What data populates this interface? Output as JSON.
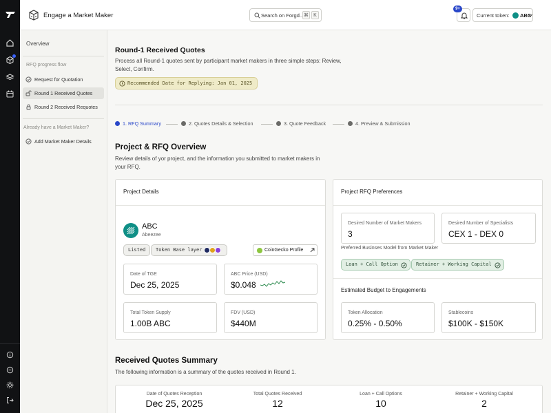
{
  "header": {
    "title": "Engage a Market Maker",
    "search_placeholder": "Search on Forgd...",
    "kbd_1": "⌘",
    "kbd_2": "K",
    "notifications_count": "9+",
    "token_label": "Current token:",
    "token_value": "ABC"
  },
  "sidebar": {
    "overview": "Overview",
    "progress_section": "RFQ progress flow",
    "items": [
      {
        "label": "Request for Quotation"
      },
      {
        "label": "Round 1 Received Quotes"
      },
      {
        "label": "Round 2 Received Requotes"
      }
    ],
    "mm_section": "Already have a Market Maker?",
    "add_mm": "Add Market Maker Details"
  },
  "main": {
    "title": "Round-1 Received Quotes",
    "lead": "Process all Round-1 quotes sent by participant market makers in three simple steps: Review, Select, Confirm.",
    "recommended": "Recommended Date for Replying: Jan 01, 2025",
    "steps": [
      {
        "label": "1. RFQ Summary"
      },
      {
        "label": "2. Quotes Details & Selection"
      },
      {
        "label": "3. Quote Feedback"
      },
      {
        "label": "4. Preview & Submission"
      }
    ],
    "overview_title": "Project & RFQ Overview",
    "overview_sub": "Review details of yor project, and the information you submitted to market makers in your RFQ."
  },
  "project": {
    "card_title": "Project Details",
    "name": "ABC",
    "subname": "Abeezee",
    "tag_listed": "Listed",
    "tag_base_layer": "Token Base layer",
    "coingecko": "CoinGecko Profile",
    "tge_label": "Date of TGE",
    "tge_value": "Dec 25, 2025",
    "price_label": "ABC Price (USD)",
    "price_value": "$0.048",
    "supply_label": "Total Token Supply",
    "supply_value": "1.00B ABC",
    "fdv_label": "FDV (USD)",
    "fdv_value": "$440M"
  },
  "rfq": {
    "card_title": "Project RFQ Preferences",
    "mm_label": "Desired Number of Market Makers",
    "mm_value": "3",
    "spec_label": "Desired Number of Specialists",
    "spec_value": "CEX 1 - DEX 0",
    "model_label": "Preferred Businses Model from Market Maker",
    "model_1": "Loan + Call Option",
    "model_2": "Retainer + Working Capital",
    "budget_title": "Estimated Budget to Engagements",
    "alloc_label": "Token Allocation",
    "alloc_value": "0.25% - 0.50%",
    "stable_label": "Stablecoins",
    "stable_value": "$100K - $150K"
  },
  "summary": {
    "title": "Received Quotes Summary",
    "sub": "The following information is a summary of the quotes received in Round 1.",
    "cols": [
      {
        "label": "Date of Quotes Reception",
        "value": "Dec 25, 2025"
      },
      {
        "label": "Total Quotes Received",
        "value": "12"
      },
      {
        "label": "Loan + Call Options",
        "value": "10"
      },
      {
        "label": "Retainer + Working Capital",
        "value": "2"
      }
    ]
  },
  "colors": {
    "accent": "#2a47c9",
    "rail": "#111214",
    "token": "#0f8f86"
  }
}
